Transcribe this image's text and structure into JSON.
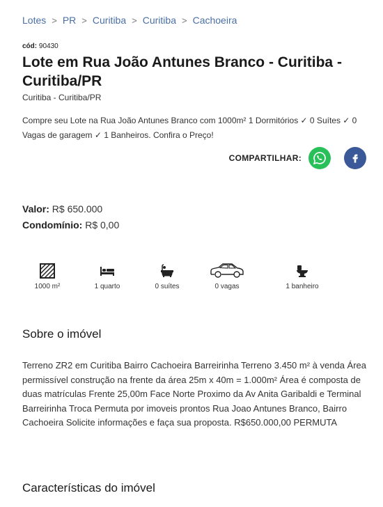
{
  "breadcrumb": [
    "Lotes",
    "PR",
    "Curitiba",
    "Curitiba",
    "Cachoeira"
  ],
  "code": {
    "label": "cód:",
    "value": "90430"
  },
  "title": "Lote em Rua João Antunes Branco - Curitiba - Curitiba/PR",
  "subtitle": "Curitiba - Curitiba/PR",
  "description": "Compre seu Lote na Rua João Antunes Branco com 1000m² 1 Dormitórios ✓ 0 Suítes ✓ 0 Vagas de garagem ✓ 1 Banheiros. Confira o Preço!",
  "share": {
    "label": "COMPARTILHAR:",
    "whatsapp_icon": "whatsapp-icon",
    "facebook_icon": "facebook-icon",
    "whatsapp_color": "#29c05a",
    "facebook_color": "#3b5998"
  },
  "pricing": {
    "valor_label": "Valor:",
    "valor": "R$ 650.000",
    "condominio_label": "Condomínio:",
    "condominio": "R$ 0,00"
  },
  "features": [
    {
      "icon": "area-icon",
      "label": "1000 m²"
    },
    {
      "icon": "bed-icon",
      "label": "1 quarto"
    },
    {
      "icon": "bathtub-icon",
      "label": "0 suítes"
    },
    {
      "icon": "car-icon",
      "label": "0 vagas"
    },
    {
      "icon": "toilet-icon",
      "label": "1 banheiro"
    }
  ],
  "about": {
    "title": "Sobre o imóvel",
    "text": "Terreno ZR2 em Curitiba Bairro Cachoeira Barreirinha Terreno 3.450 m² à venda Área permissível construção na frente da área 25m x 40m = 1.000m² Área é composta de duas matrículas Frente 25,00m Face Norte Proximo da Av Anita Garibaldi e Terminal Barreirinha Troca Permuta por imoveis prontos Rua Joao Antunes Branco, Bairro Cachoeira Solicite informações e faça sua proposta. R$650.000,00 PERMUTA"
  },
  "characteristics": {
    "title": "Características do imóvel"
  }
}
